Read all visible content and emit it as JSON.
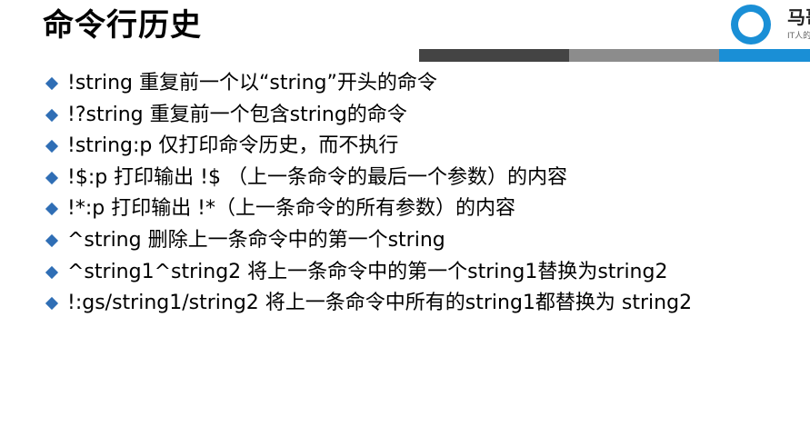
{
  "title": "命令行历史",
  "logo": {
    "name": "马哥",
    "sub": "IT人的"
  },
  "colors": {
    "bullet": "#2f6eb5",
    "bar_dark": "#444444",
    "bar_gray": "#8c8c8c",
    "bar_blue": "#1a8fd6"
  },
  "items": [
    "!string 重复前一个以“string”开头的命令",
    "!?string 重复前一个包含string的命令",
    "!string:p 仅打印命令历史，而不执行",
    "!$:p 打印输出 !$ （上一条命令的最后一个参数）的内容",
    "!*:p 打印输出 !*（上一条命令的所有参数）的内容",
    "^string 删除上一条命令中的第一个string",
    "^string1^string2 将上一条命令中的第一个string1替换为string2",
    "!:gs/string1/string2 将上一条命令中所有的string1都替换为 string2"
  ]
}
